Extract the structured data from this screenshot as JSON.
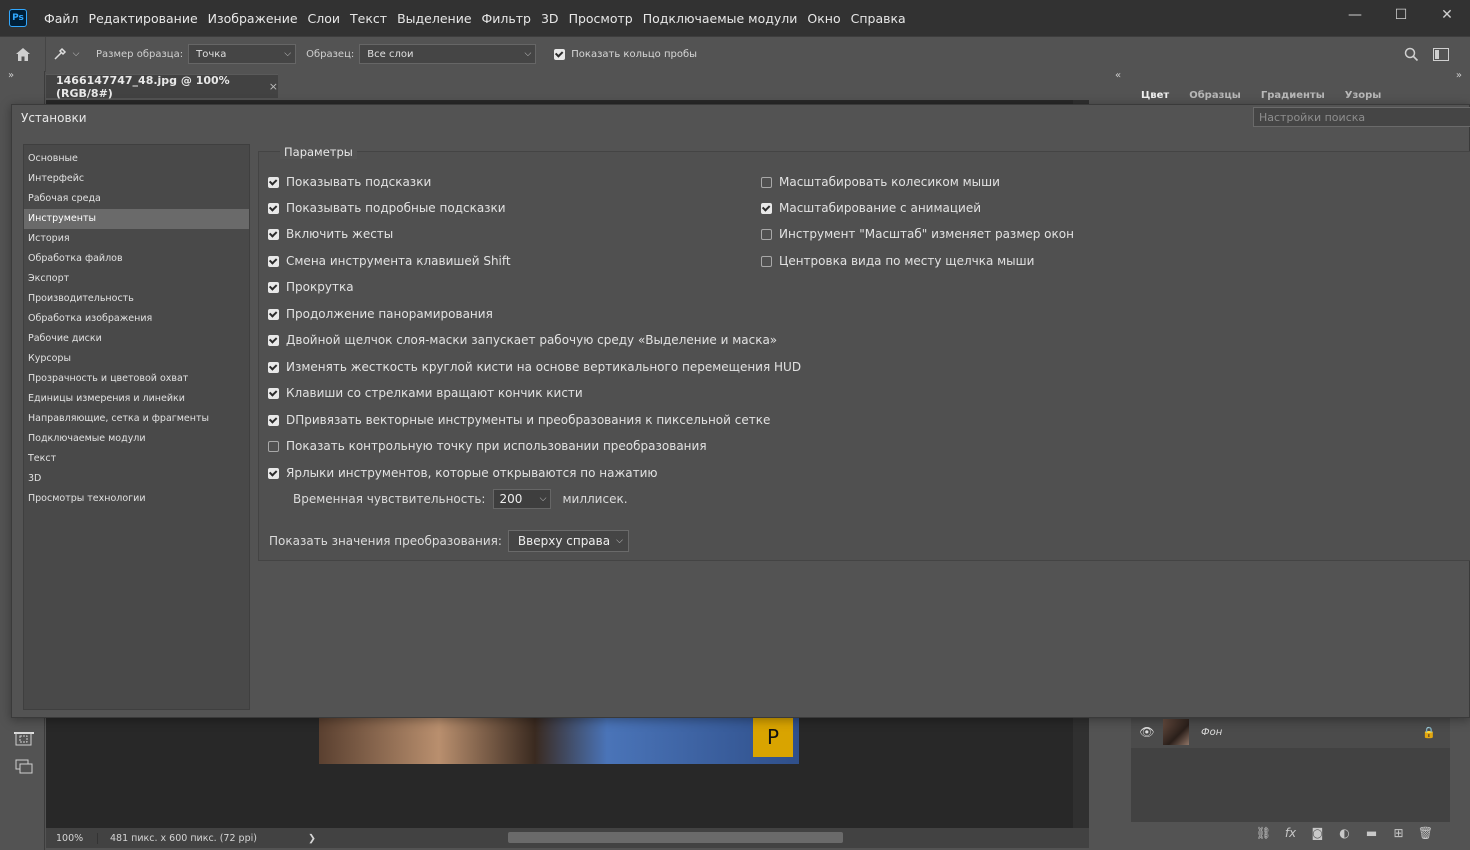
{
  "app": {
    "logo": "Ps",
    "menu": [
      "Файл",
      "Редактирование",
      "Изображение",
      "Слои",
      "Текст",
      "Выделение",
      "Фильтр",
      "3D",
      "Просмотр",
      "Подключаемые модули",
      "Окно",
      "Справка"
    ],
    "window_controls": {
      "minimize": "—",
      "maximize": "☐",
      "close": "✕"
    }
  },
  "options_bar": {
    "sample_size_label": "Размер образца:",
    "sample_size_value": "Точка",
    "sample_label": "Образец:",
    "sample_value": "Все слои",
    "show_ring_label": "Показать кольцо пробы",
    "show_ring_checked": true
  },
  "document": {
    "tab_title": "1466147747_48.jpg @ 100% (RGB/8#)",
    "tab_close": "×",
    "zoom": "100%",
    "dimensions": "481 пикс. x 600 пикс. (72 ppi)",
    "status_arrow": "❯",
    "badge": "P"
  },
  "panels": {
    "tabs": [
      "Цвет",
      "Образцы",
      "Градиенты",
      "Узоры"
    ],
    "active_tab": "Цвет",
    "collapse_left": "»",
    "collapse_right": "«",
    "layer": {
      "name": "Фон"
    }
  },
  "preferences": {
    "title": "Установки",
    "search_placeholder": "Настройки поиска",
    "nav": [
      {
        "label": "Основные",
        "selected": false
      },
      {
        "label": "Интерфейс",
        "selected": false
      },
      {
        "label": "Рабочая среда",
        "selected": false
      },
      {
        "label": "Инструменты",
        "selected": true
      },
      {
        "label": "История",
        "selected": false
      },
      {
        "label": "Обработка файлов",
        "selected": false
      },
      {
        "label": "Экспорт",
        "selected": false
      },
      {
        "label": "Производительность",
        "selected": false
      },
      {
        "label": "Обработка изображения",
        "selected": false
      },
      {
        "label": "Рабочие диски",
        "selected": false
      },
      {
        "label": "Курсоры",
        "selected": false
      },
      {
        "label": "Прозрачность и цветовой охват",
        "selected": false
      },
      {
        "label": "Единицы измерения и линейки",
        "selected": false
      },
      {
        "label": "Направляющие, сетка и фрагменты",
        "selected": false
      },
      {
        "label": "Подключаемые модули",
        "selected": false
      },
      {
        "label": "Текст",
        "selected": false
      },
      {
        "label": "3D",
        "selected": false
      },
      {
        "label": "Просмотры технологии",
        "selected": false
      }
    ],
    "params_title": "Параметры",
    "left_options": [
      {
        "label": "Показывать подсказки",
        "checked": true
      },
      {
        "label": "Показывать подробные подсказки",
        "checked": true
      },
      {
        "label": "Включить жесты",
        "checked": true
      },
      {
        "label": "Смена инструмента клавишей Shift",
        "checked": true
      },
      {
        "label": "Прокрутка",
        "checked": true
      },
      {
        "label": "Продолжение панорамирования",
        "checked": true
      },
      {
        "label": "Двойной щелчок слоя-маски запускает рабочую среду «Выделение и маска»",
        "checked": true
      },
      {
        "label": "Изменять жесткость круглой кисти на основе вертикального перемещения HUD",
        "checked": true
      },
      {
        "label": "Клавиши со стрелками вращают кончик кисти",
        "checked": true
      },
      {
        "label": "DПривязать векторные инструменты и преобразования к пиксельной сетке",
        "checked": true
      },
      {
        "label": "Показать контрольную точку при использовании преобразования",
        "checked": false
      },
      {
        "label": "Ярлыки инструментов, которые открываются по нажатию",
        "checked": true
      }
    ],
    "right_options": [
      {
        "label": "Масштабировать колесиком мыши",
        "checked": false
      },
      {
        "label": "Масштабирование с анимацией",
        "checked": true
      },
      {
        "label": "Инструмент \"Масштаб\" изменяет размер окон",
        "checked": false
      },
      {
        "label": "Центровка вида по месту щелчка мыши",
        "checked": false
      }
    ],
    "sensitivity_label": "Временная чувствительность:",
    "sensitivity_value": "200",
    "sensitivity_unit": "миллисек.",
    "transform_label": "Показать значения преобразования:",
    "transform_value": "Вверху справа"
  }
}
